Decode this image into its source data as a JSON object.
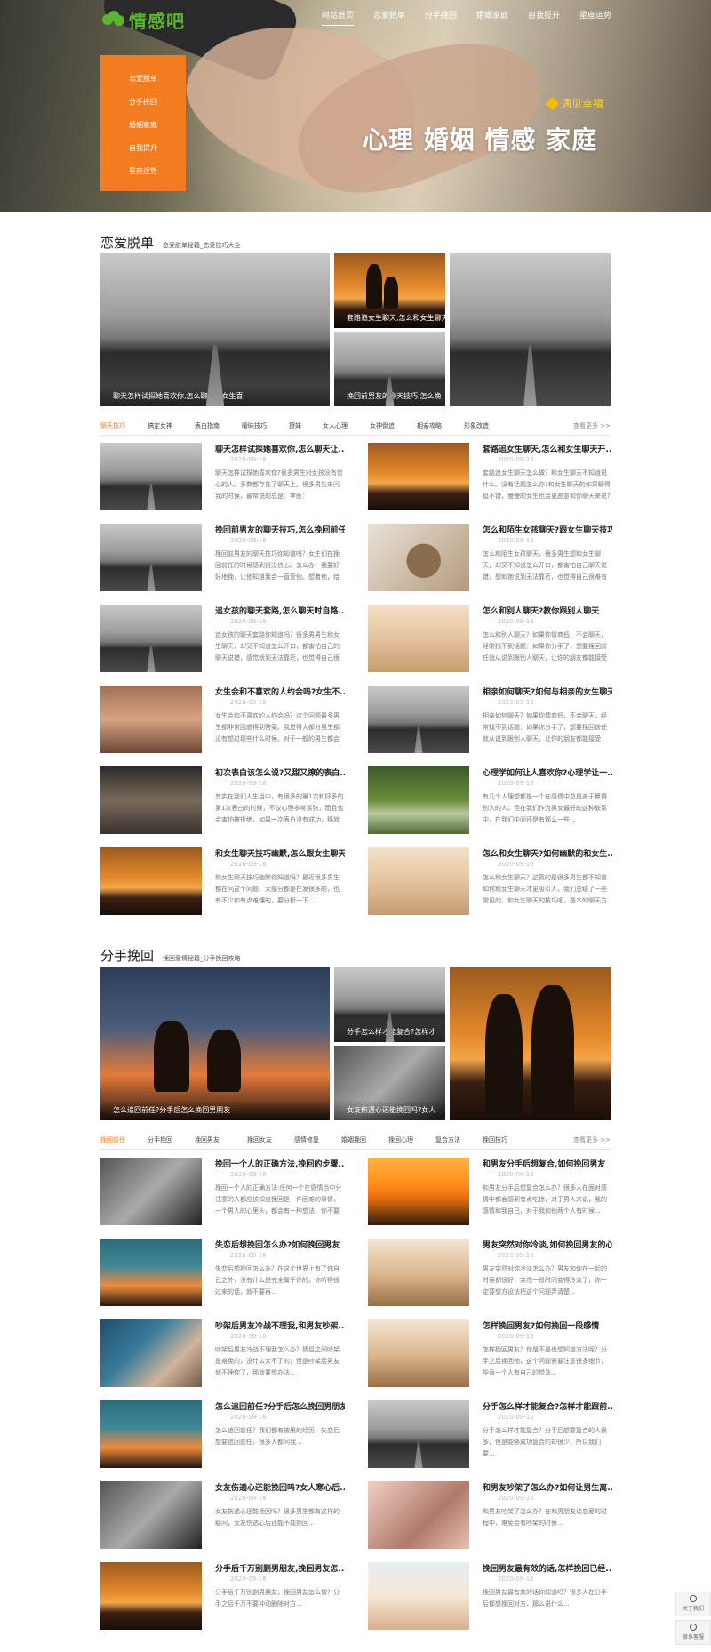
{
  "site": {
    "logo_text": "情感吧"
  },
  "nav": {
    "items": [
      "网站首页",
      "恋爱脱单",
      "分手挽回",
      "婚姻家庭",
      "自我提升",
      "星座运势"
    ],
    "active": 0
  },
  "side_menu": [
    "恋爱脱单",
    "分手挽回",
    "婚姻家庭",
    "自我提升",
    "星座运势"
  ],
  "hero": {
    "tag": "遇见幸福",
    "slogan": "心理 婚姻 情感 家庭"
  },
  "section1": {
    "title": "恋爱脱单",
    "subtitle": "恋爱脱单秘籍_恋爱技巧大全",
    "featured": [
      {
        "caption": "聊天怎样试探她喜欢你,怎么聊天让女生喜",
        "style": "road"
      },
      {
        "caption": "套路追女生聊天,怎么和女生聊天",
        "style": "sunset"
      },
      {
        "caption": "挽回前男友的聊天技巧,怎么挽",
        "style": "road"
      },
      {
        "caption": "",
        "style": "road"
      }
    ],
    "tabs": [
      "聊天技巧",
      "搞定女神",
      "表白指南",
      "暧昧技巧",
      "撩妹",
      "女人心理",
      "女神倒追",
      "相亲攻略",
      "形象改造"
    ],
    "more": "查看更多 >>",
    "items": [
      {
        "title": "聊天怎样试探她喜欢你,怎么聊天让...",
        "date": "2020-09-16",
        "summary": "聊天怎样试探她喜欢你?很多男生对女孩没有信心的人。多数都存在了聊天上。很多男生来问我的时候，最常说的总是：李医：",
        "style": "road"
      },
      {
        "title": "套路追女生聊天,怎么和女生聊天开...",
        "date": "2020-09-16",
        "summary": "套路追女生聊天怎么做？和女生聊天不知道说什么。没有话题怎么办?和女生聊天的如果聊得挺不错，慢慢的女生也会更愿意和你聊天来说?",
        "style": "sunset"
      },
      {
        "title": "挽回前男友的聊天技巧,怎么挽回前任",
        "date": "2020-09-16",
        "summary": "挽回前男友的聊天技巧你知道吗？女生们在挽回前任的时候感到很没信心。怎么办：我要好好地挽，让他知道我会一直爱他。想着他，给一些安慰和关心",
        "style": "road"
      },
      {
        "title": "怎么和陌生女孩聊天?跟女生聊天技巧",
        "date": "2020-09-16",
        "summary": "怎么和陌生女孩聊天，很多男生想和女生聊天，却又不知道怎么开口，都害怕自己聊天说错，想和她说到无法靠近，也觉得自己很难有话题。",
        "style": "cat"
      },
      {
        "title": "追女孩的聊天套路,怎么聊天时自路...",
        "date": "2020-09-16",
        "summary": "追女孩的聊天套路你知道吗？很多男男生和女生聊天，却又不知道怎么开口，都害怕自己的聊天说错，感觉就到无法靠近，也觉得自己很难有话题，其...",
        "style": "road"
      },
      {
        "title": "怎么和别人聊天?教你跟别人聊天",
        "date": "2020-09-16",
        "summary": "怎么和别人聊天？如果你情商低，不会聊天，经常找不到话题：如果你分手了，想要挽回前任就从说到跟别人聊天，让你的朋友都能接受你，学会一段好对话...",
        "style": "beach"
      },
      {
        "title": "女生会和不喜欢的人约会吗?女生不...",
        "date": "2020-09-16",
        "summary": "女生会和不喜欢的人约会吗？这个问题最多男生都非常困惑得到答案。我觉得大部分男生都没有想过那些什么时候。对于一般的男生都会自己的真挚...",
        "style": "skin"
      },
      {
        "title": "相亲如何聊天?如何与相亲的女生聊天",
        "date": "2020-09-16",
        "summary": "相亲如何聊天？如果你情商低，不会聊天，经常找不到话题：如果你分手了，想要挽回前任就从说到跟别人聊天，让你的朋友都能接受你，关系越来越多...",
        "style": "road"
      },
      {
        "title": "初次表白该怎么说?又甜又撩的表白...",
        "date": "2020-09-16",
        "summary": "其实在我们人生当中，有很多的第1次和好多的第1次表白的时候，不仅心理非常紧张，而且也会害怕被拒绝，如果一次表白没有成功，那就再来...",
        "style": "station"
      },
      {
        "title": "心理学如何让人喜欢你?心理学让一...",
        "date": "2020-09-16",
        "summary": "有几个人理想都是一个在感情中总是善于赢得别人的人。但在我们作为男女最好的这种联系中，在我们中间还是有那么一些...",
        "style": "forest"
      },
      {
        "title": "和女生聊天技巧幽默,怎么跟女生聊天",
        "date": "2020-09-16",
        "summary": "和女生聊天技巧幽默你知道吗？最近很多男生都在问这个问题，大部分都是在发很多的，也有不少和有点难懂的，要分析一下...",
        "style": "sunset"
      },
      {
        "title": "怎么和女生聊天?如何幽默的和女生...",
        "date": "2020-09-16",
        "summary": "怎么和女生聊天？这真的是很多男生都不知道如何和女生聊天才更吸引人，我们总结了一些常见的，和女生聊天的技巧吧，基本的聊天方法：（致谢你，你会想到...",
        "style": "beach"
      }
    ]
  },
  "section2": {
    "title": "分手挽回",
    "subtitle": "挽回爱情秘籍_分手挽回攻略",
    "featured": [
      {
        "caption": "怎么追回前任?分手后怎么挽回男朋友",
        "style": "dusk"
      },
      {
        "caption": "分手怎么样才能复合?怎样才",
        "style": "road"
      },
      {
        "caption": "女友伤透心还能挽回吗?女人",
        "style": "bw"
      },
      {
        "caption": "",
        "style": "sunset"
      }
    ],
    "tabs": [
      "挽回前任",
      "分手挽回",
      "挽回男友",
      "挽回女友",
      "感情修复",
      "婚姻挽回",
      "挽回心理",
      "复合方法",
      "挽回技巧"
    ],
    "more": "查看更多 >>",
    "items": [
      {
        "title": "挽回一个人的正确方法,挽回的步骤...",
        "date": "2020-09-16",
        "summary": "挽回一个人的正确方法:任何一个在感情当中分注意的人都应该知道挽回是一件困难的事情，一个男人的心里头，都会有一种想法，你不要再...",
        "style": "bw"
      },
      {
        "title": "和男友分手后想复合,如何挽回男友",
        "date": "2020-09-16",
        "summary": "和男友分手后想复合怎么办？很多人在面对感情中都会感到有点吃惊，对于男人来说，我的感情和我自己，对于我和他两个人有时候...",
        "style": "sunset2"
      },
      {
        "title": "失恋后想挽回怎么办?如何挽回男友",
        "date": "2020-09-16",
        "summary": "失恋后想挽回怎么办？在这个世界上有了你自己之外，没有什么是完全属于你的。你听得很过来的话，就不要再...",
        "style": "teal"
      },
      {
        "title": "男友突然对你冷淡,如何挽回男友的心",
        "date": "2020-09-16",
        "summary": "男友突然对你冷淡怎么办？男友和你在一起的时候都很好，突然一段时间变得冷淡了，你一定要想方设法把这个问题弄清楚...",
        "style": "camel"
      },
      {
        "title": "吵架后男友冷战不理我,和男友吵架...",
        "date": "2020-09-16",
        "summary": "吵架后男友冷战不理我怎么办？情侣之间吵架是难免的，没什么大不了的，但是吵架后男友就不理你了，那就要想办法...",
        "style": "handsdesk"
      },
      {
        "title": "怎样挽回男友?如何挽回一段感情",
        "date": "2020-09-16",
        "summary": "怎样挽回男友？你是不是也想知道方法呢？分手之后挽回他，这个问题需要注意很多细节，毕竟一个人有自己的想法...",
        "style": "camel"
      },
      {
        "title": "怎么追回前任?分手后怎么挽回男朋友",
        "date": "2020-09-16",
        "summary": "怎么追回前任？我们都有被甩的经历，失恋后想要追回前任，很多人都问我...",
        "style": "teal"
      },
      {
        "title": "分手怎么样才能复合?怎样才能跟前...",
        "date": "2020-09-16",
        "summary": "分手怎么样才能复合？分手后想要复合的人很多，但是能够成功复合的却很少，所以我们要...",
        "style": "road"
      },
      {
        "title": "女友伤透心还能挽回吗?女人寒心后...",
        "date": "2020-09-16",
        "summary": "女友伤透心还能挽回吗？很多男生都有这样的疑问，女友伤透心后还能不能挽回...",
        "style": "bw"
      },
      {
        "title": "和男友吵架了怎么办?如何让男生离...",
        "date": "2020-09-16",
        "summary": "和男友吵架了怎么办？在和男朋友谈恋爱的过程中，难免会有吵架的时候...",
        "style": "pink"
      },
      {
        "title": "分手后千万别删男朋友,挽回男友怎...",
        "date": "2020-09-16",
        "summary": "分手后千万别删男朋友，挽回男友怎么做？分手之后千万不要冲动删除对方...",
        "style": "sunset"
      },
      {
        "title": "挽回男友最有效的话,怎样挽回已经...",
        "date": "2020-09-16",
        "summary": "挽回男友最有效的话你知道吗？很多人在分手后都想挽回对方，那么说什么...",
        "style": "wedding"
      }
    ]
  },
  "side_tools": [
    {
      "label": "关于我们",
      "icon": "user-icon"
    },
    {
      "label": "联系客服",
      "icon": "headset-icon"
    }
  ]
}
